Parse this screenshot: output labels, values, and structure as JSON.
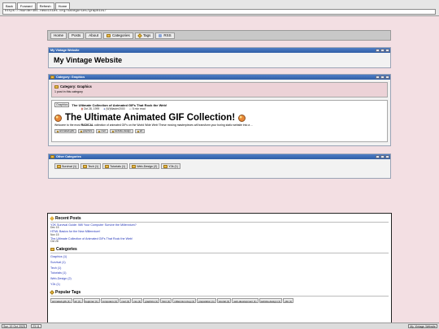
{
  "browser": {
    "back": "Back",
    "forward": "Forward",
    "refresh": "Refresh",
    "home": "Home",
    "url": "https://murder401.neocities.org/categories/graphics/"
  },
  "nav": {
    "items": [
      "Home",
      "Posts",
      "About",
      "Categories",
      "Tags",
      "RSS"
    ]
  },
  "site_window": {
    "title": "My Vintage Website",
    "heading": "My Vintage Website"
  },
  "category_window": {
    "title": "Category: Graphics",
    "heading": "Category: Graphics",
    "count": "1 post in this category",
    "post": {
      "thumb_alt": "Graphics",
      "title": "The Ultimate Collection of Animated GIFs That Rock the Web!",
      "date": "Oct 28, 1999",
      "author": "(W)Master2000",
      "read": "5 min read",
      "big_title": "The Ultimate Animated GIF Collection!",
      "excerpt_pre": "Welcome to the most ",
      "excerpt_bold": "RADICAL",
      "excerpt_post": " collection of animated GIFs on the World Wide Web! These moving masterpieces will transform your boring static website into a ...",
      "tags": [
        "animated-gifs",
        "graphics",
        "cool",
        "website-design",
        "art"
      ]
    }
  },
  "other_window": {
    "title": "Other Categories",
    "categories": [
      "Survival (1)",
      "Tech (1)",
      "Tutorials (1)",
      "Web-Design (2)",
      "Y2k (1)"
    ]
  },
  "footer": {
    "recent_title": "Recent Posts",
    "recent": [
      {
        "title": "Y2K Survival Guide: Will Your Computer Survive the Millennium?",
        "date": "Dec 15"
      },
      {
        "title": "HTML Basics for the New Millennium!",
        "date": "Nov 15"
      },
      {
        "title": "The Ultimate Collection of Animated GIFs That Rock the Web!",
        "date": "Oct 28"
      }
    ],
    "categories_title": "Categories",
    "categories": [
      "Graphics (1)",
      "Survival (1)",
      "Tech (1)",
      "Tutorials (1)",
      "Web-Design (2)",
      "Y2k (1)"
    ],
    "tags_title": "Popular Tags",
    "tags": [
      "animated-gifs (1)",
      "art (1)",
      "beginner (1)",
      "computers (1)",
      "cool (1)",
      "css (1)",
      "graphics (1)",
      "html (1)",
      "millennium-bug (1)",
      "preparation (1)",
      "tutorial (1)",
      "web-development (1)",
      "website-design (1)",
      "y2k (1)"
    ]
  },
  "taskbar": {
    "datetime_date": "Sun 19 Oct 2025",
    "datetime_time": "23:11",
    "window": "My Vintage Website"
  }
}
